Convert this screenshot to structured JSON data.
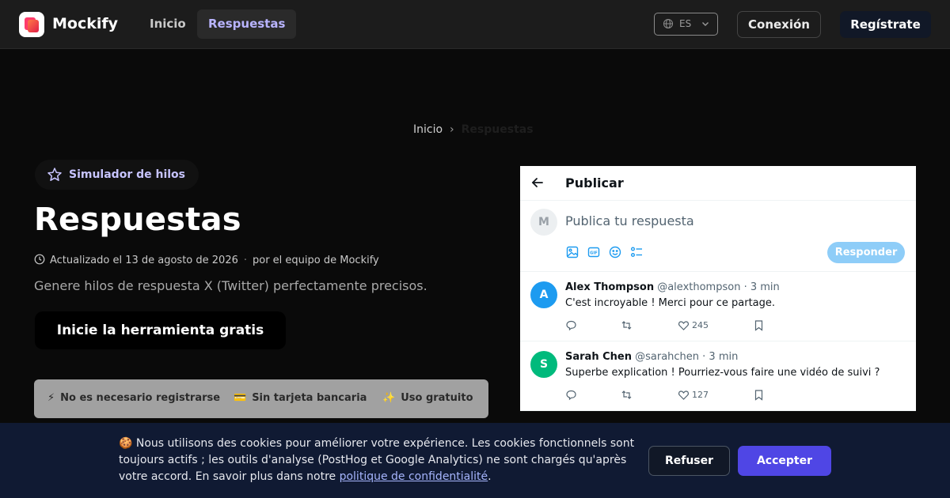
{
  "navbar": {
    "brand": "Mockify",
    "links": [
      "Inicio",
      "Respuestas"
    ],
    "language_code": "ES",
    "login_label": "Conexión",
    "signup_label": "Regístrate"
  },
  "breadcrumb": {
    "home": "Inicio",
    "current": "Respuestas"
  },
  "hero": {
    "badge_label": "Simulador de hilos",
    "title": "Respuestas",
    "updated": "Actualizado el 13 de agosto de 2026",
    "author": "por el equipo de Mockify",
    "description": "Genere hilos de respuesta X (Twitter) perfectamente precisos.",
    "cta_label": "Inicie la herramienta gratis",
    "features": [
      {
        "icon": "⚡",
        "label": "No es necesario registrarse"
      },
      {
        "icon": "💳",
        "label": "Sin tarjeta bancaria"
      },
      {
        "icon": "✨",
        "label": "Uso gratuito"
      }
    ]
  },
  "tweet_panel": {
    "header_title": "Publicar",
    "compose": {
      "avatar_initial": "M",
      "placeholder": "Publica tu respuesta",
      "reply_button": "Responder"
    },
    "replies": [
      {
        "initial": "A",
        "avatar_color": "#1d9bf0",
        "name": "Alex Thompson",
        "handle": "@alexthompson",
        "time": "· 3 min",
        "text": "C'est incroyable ! Merci pour ce partage.",
        "likes": "245"
      },
      {
        "initial": "S",
        "avatar_color": "#00ba7c",
        "name": "Sarah Chen",
        "handle": "@sarahchen",
        "time": "· 3 min",
        "text": "Superbe explication ! Pourriez-vous faire une vidéo de suivi ?",
        "likes": "127"
      }
    ]
  },
  "cookie_banner": {
    "text": "🍪 Nous utilisons des cookies pour améliorer votre expérience. Les cookies fonctionnels sont toujours actifs ; les outils d'analyse (PostHog et Google Analytics) ne sont chargés qu'après votre accord. En savoir plus dans notre ",
    "policy_link": "politique de confidentialité",
    "text_end": ".",
    "refuse_label": "Refuser",
    "accept_label": "Accepter"
  },
  "colors": {
    "accent": "#4f46e5",
    "badge_text": "#c7c4ff",
    "reply_button": "#8ecdf8"
  }
}
